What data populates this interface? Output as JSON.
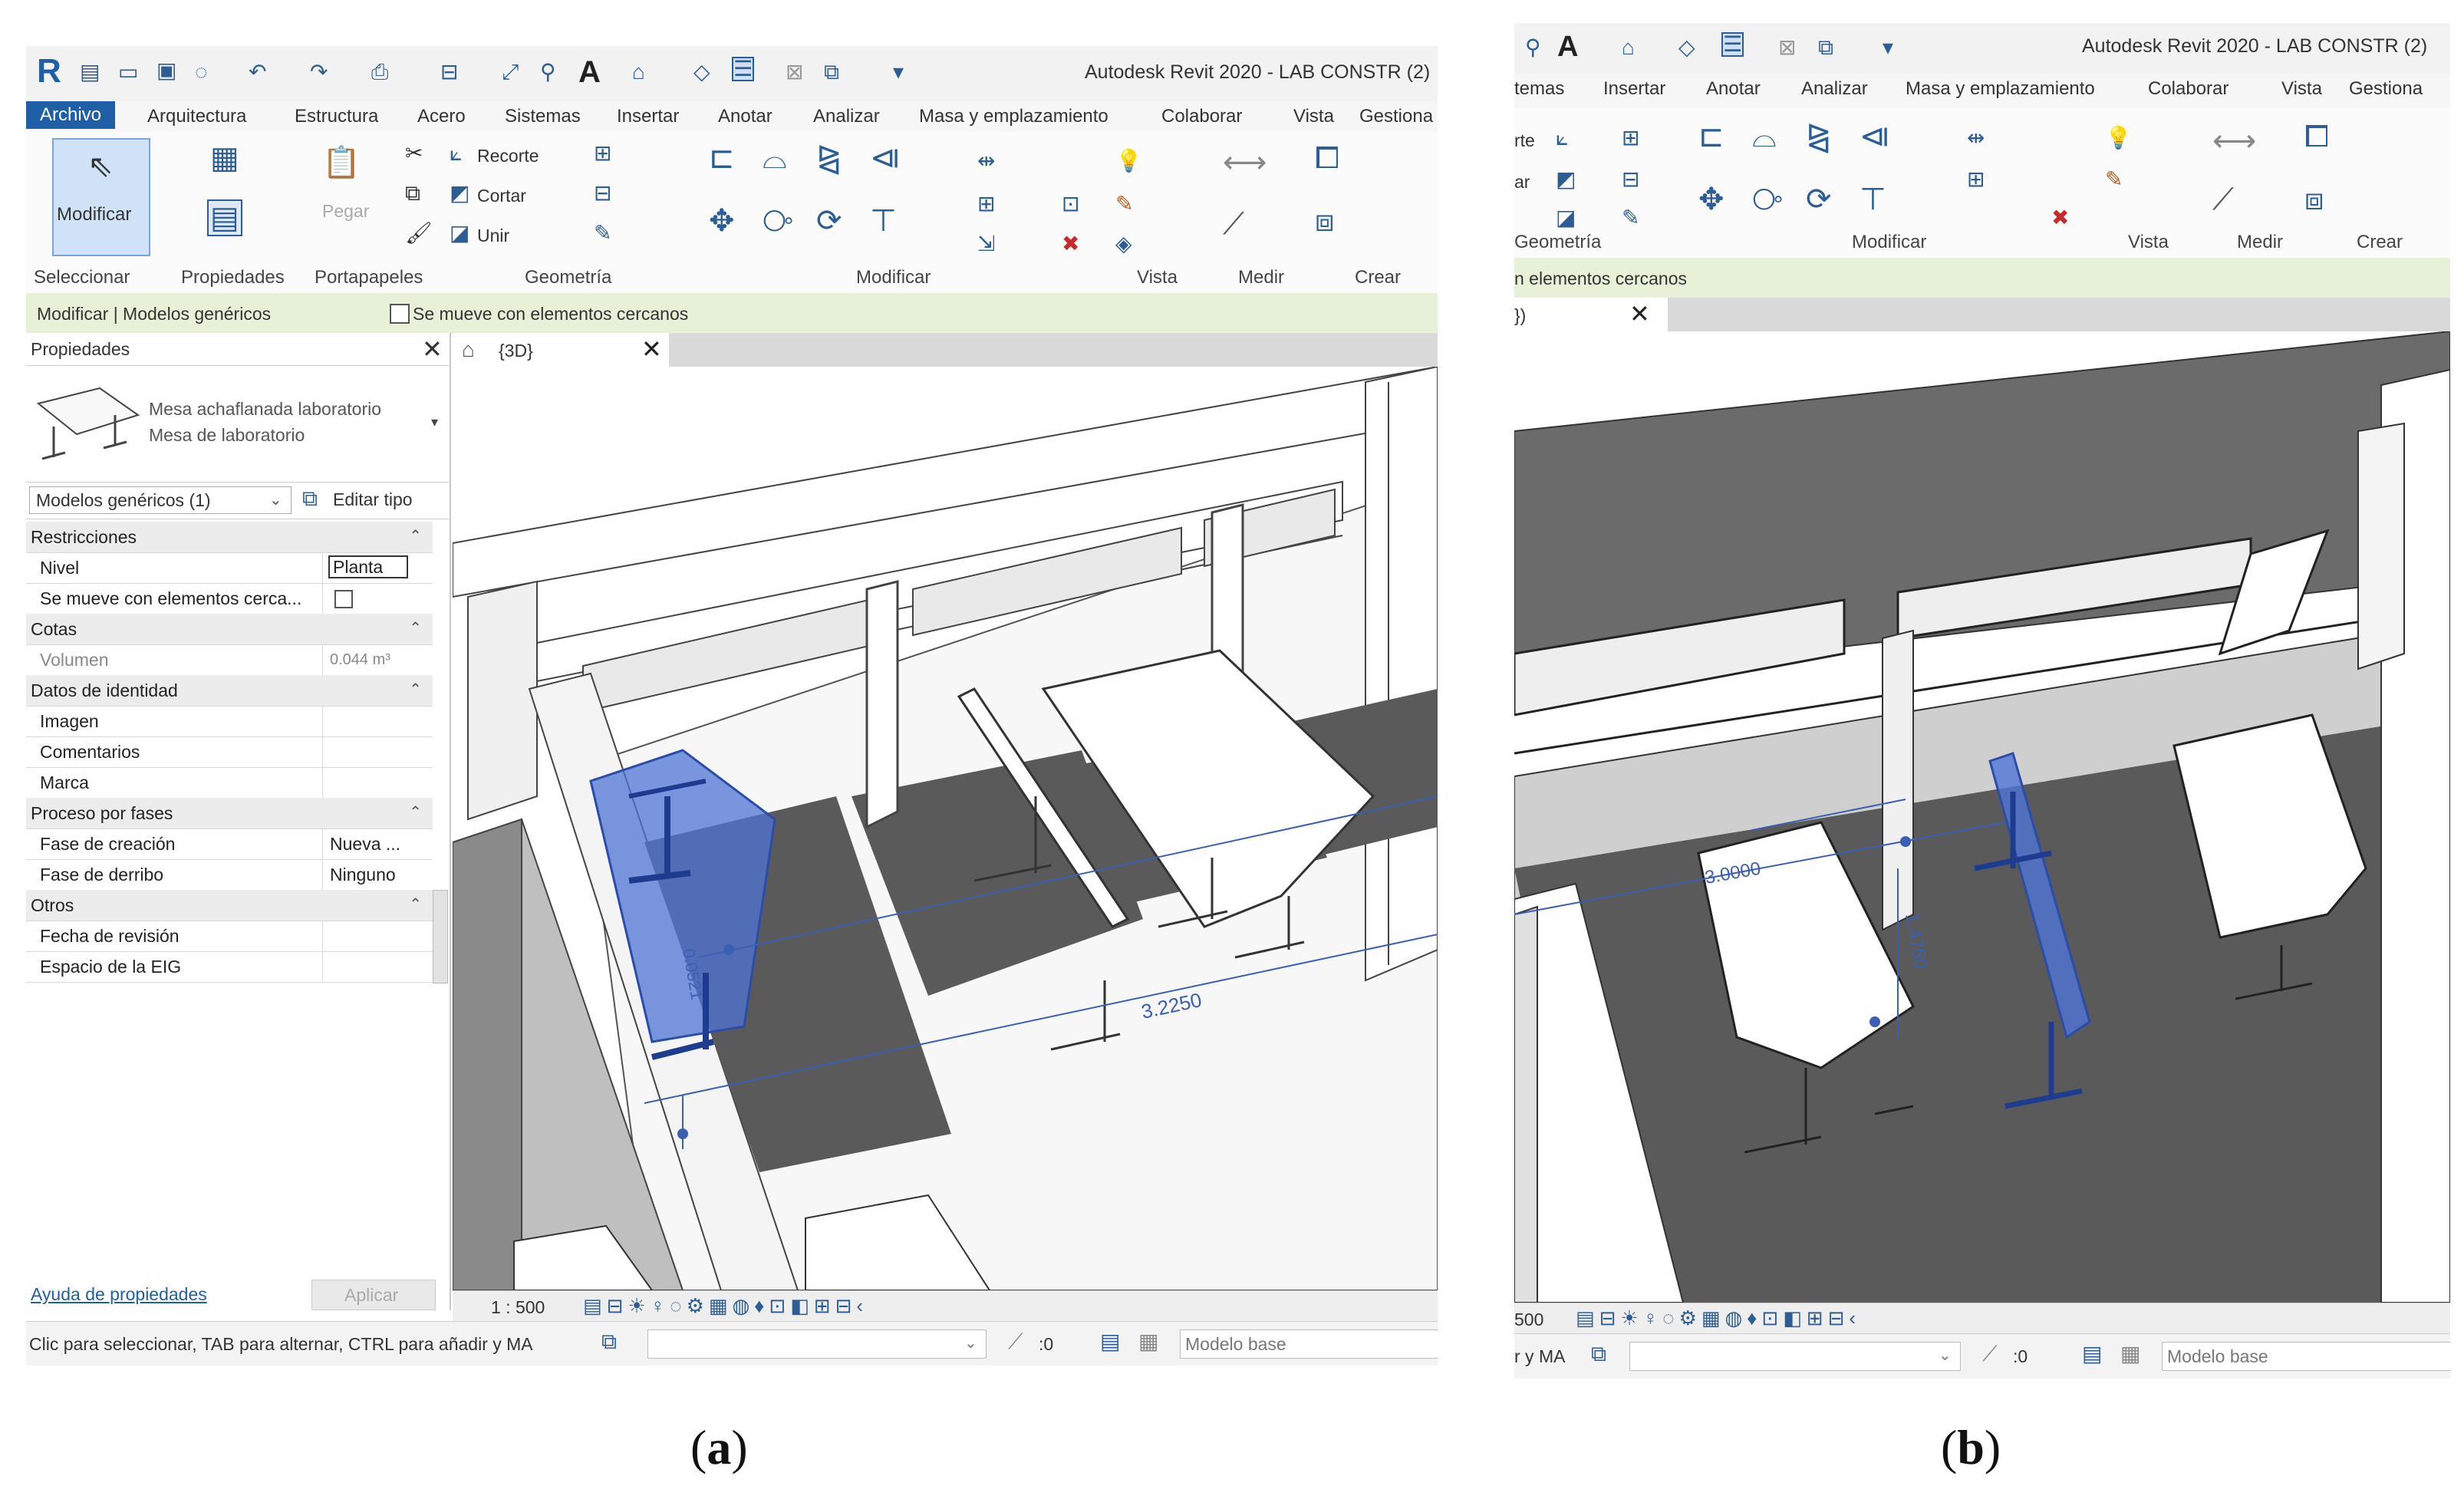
{
  "panel_a": {
    "title": "Autodesk Revit 2020 - LAB CONSTR (2)",
    "tabs": [
      "Archivo",
      "Arquitectura",
      "Estructura",
      "Acero",
      "Sistemas",
      "Insertar",
      "Anotar",
      "Analizar",
      "Masa y emplazamiento",
      "Colaborar",
      "Vista",
      "Gestiona"
    ],
    "ribbon": {
      "modify_label": "Modificar",
      "paste_label": "Pegar",
      "clipboard_items": [
        "Recorte",
        "Cortar",
        "Unir"
      ],
      "groups": [
        "Seleccionar",
        "Propiedades",
        "Portapapeles",
        "Geometría",
        "Modificar",
        "Vista",
        "Medir",
        "Crear"
      ]
    },
    "context_bar": {
      "label": "Modificar | Modelos genéricos",
      "checkbox_label": "Se mueve con elementos cercanos"
    },
    "properties": {
      "header": "Propiedades",
      "type_name": "Mesa achaflanada laboratorio",
      "type_family": "Mesa de laboratorio",
      "selector": "Modelos genéricos (1)",
      "edit_type": "Editar tipo",
      "rows": [
        {
          "k": "Restricciones",
          "v": "",
          "section": true
        },
        {
          "k": "Nivel",
          "v": "Planta"
        },
        {
          "k": "Se mueve con elementos cerca...",
          "v": ""
        },
        {
          "k": "Cotas",
          "v": "",
          "section": true
        },
        {
          "k": "Volumen",
          "v": "0.044 m³"
        },
        {
          "k": "Datos de identidad",
          "v": "",
          "section": true
        },
        {
          "k": "Imagen",
          "v": ""
        },
        {
          "k": "Comentarios",
          "v": ""
        },
        {
          "k": "Marca",
          "v": ""
        },
        {
          "k": "Proceso por fases",
          "v": "",
          "section": true
        },
        {
          "k": "Fase de creación",
          "v": "Nueva ..."
        },
        {
          "k": "Fase de derribo",
          "v": "Ninguno"
        },
        {
          "k": "Otros",
          "v": "",
          "section": true
        },
        {
          "k": "Fecha de revisión",
          "v": ""
        },
        {
          "k": "Espacio de la EIG",
          "v": ""
        }
      ],
      "help_link": "Ayuda de propiedades",
      "apply_button": "Aplicar"
    },
    "view_tab": "{3D}",
    "dim_long": "3.2250",
    "dim_short": "0.0521",
    "scale": "1 : 500",
    "status_text": "Clic para seleccionar, TAB para alternar, CTRL para añadir y MA",
    "coord": ":0",
    "model": "Modelo base"
  },
  "panel_b": {
    "title": "Autodesk Revit 2020 - LAB CONSTR (2)",
    "tabs": [
      "temas",
      "Insertar",
      "Anotar",
      "Analizar",
      "Masa y emplazamiento",
      "Colaborar",
      "Vista",
      "Gestiona"
    ],
    "groups": [
      "Geometría",
      "Modificar",
      "Vista",
      "Medir",
      "Crear"
    ],
    "left_items": [
      "rte",
      "ar"
    ],
    "context_text": "n elementos cercanos",
    "view_tab": "})",
    "dim_a": "3.0000",
    "dim_b": "1.4750",
    "scale": "500",
    "status_text": "r y MA",
    "coord": ":0",
    "model": "Modelo base"
  },
  "captions": {
    "a": "a",
    "b": "b"
  },
  "colors": {
    "accent": "#1f5fa8",
    "selection": "#4f74d6",
    "context_bar": "#e6f1d8",
    "shadow": "#5a5a5a"
  }
}
